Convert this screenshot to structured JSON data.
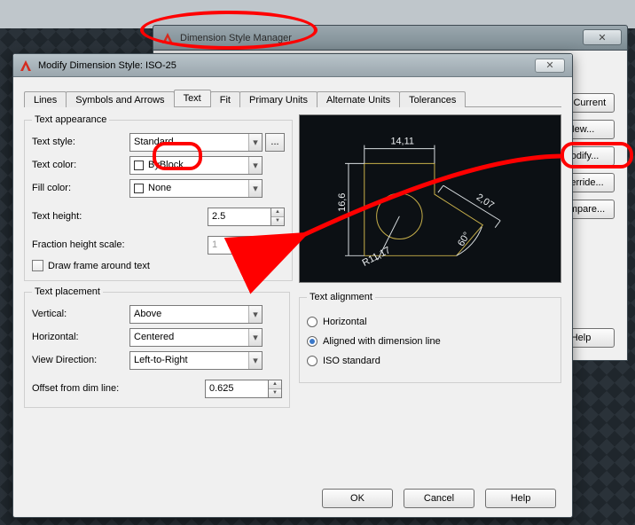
{
  "back_window": {
    "title": "Dimension Style Manager",
    "buttons": {
      "set_current": "Set Current",
      "new": "New...",
      "modify": "Modify...",
      "override": "Override...",
      "compare": "Compare...",
      "help": "Help"
    }
  },
  "dialog": {
    "title": "Modify Dimension Style: ISO-25",
    "close_glyph": "✕",
    "tabs": [
      "Lines",
      "Symbols and Arrows",
      "Text",
      "Fit",
      "Primary Units",
      "Alternate Units",
      "Tolerances"
    ],
    "active_tab": "Text"
  },
  "text_appearance": {
    "legend": "Text appearance",
    "style_label": "Text style:",
    "style_value": "Standard",
    "ellipsis": "...",
    "color_label": "Text color:",
    "color_value": "ByBlock",
    "fill_label": "Fill color:",
    "fill_value": "None",
    "height_label": "Text height:",
    "height_value": "2.5",
    "fraction_label": "Fraction height scale:",
    "fraction_value": "1",
    "frame_label": "Draw frame around text"
  },
  "text_placement": {
    "legend": "Text placement",
    "vertical_label": "Vertical:",
    "vertical_value": "Above",
    "horizontal_label": "Horizontal:",
    "horizontal_value": "Centered",
    "viewdir_label": "View Direction:",
    "viewdir_value": "Left-to-Right",
    "offset_label": "Offset from dim line:",
    "offset_value": "0.625"
  },
  "text_alignment": {
    "legend": "Text alignment",
    "opt1": "Horizontal",
    "opt2": "Aligned with dimension line",
    "opt3": "ISO standard",
    "selected": 1
  },
  "preview": {
    "dim_top": "14,11",
    "dim_left": "16,6",
    "dim_right": "2,07",
    "dim_angle": "60°",
    "dim_radius": "R11,17"
  },
  "footer": {
    "ok": "OK",
    "cancel": "Cancel",
    "help": "Help"
  },
  "glyphs": {
    "dd": "▾",
    "up": "▲",
    "dn": "▼"
  }
}
